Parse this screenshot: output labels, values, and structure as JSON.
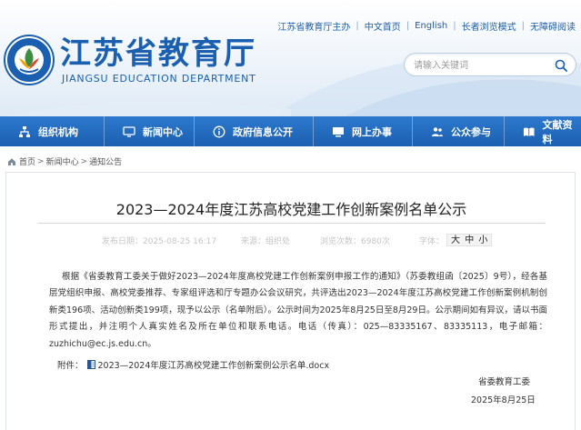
{
  "top_links": [
    "江苏省教育厅主办",
    "中文首页",
    "English",
    "长者浏览模式",
    "无障碍阅读"
  ],
  "site": {
    "name": "江苏省教育厅",
    "name_en": "JIANGSU EDUCATION DEPARTMENT"
  },
  "search": {
    "placeholder": "请输入关键词",
    "icon": "search-icon"
  },
  "nav": [
    {
      "label": "组织机构",
      "icon": "org-chart-icon"
    },
    {
      "label": "新闻中心",
      "icon": "monitor-icon"
    },
    {
      "label": "政府信息公开",
      "icon": "info-icon"
    },
    {
      "label": "网上办事",
      "icon": "computer-icon"
    },
    {
      "label": "公众参与",
      "icon": "people-icon"
    },
    {
      "label": "文献资料",
      "icon": "book-icon"
    }
  ],
  "breadcrumb": [
    "首页",
    "新闻中心",
    "通知公告"
  ],
  "article": {
    "title": "2023—2024年度江苏高校党建工作创新案例名单公示",
    "published": "发布日期：2025-08-25 16:17",
    "source": "来源：组织处",
    "views": "浏览次数：6980次",
    "font_label": "字体：",
    "font_sizes": [
      "大",
      "中",
      "小"
    ],
    "body": "根据《省委教育工委关于做好2023—2024年度高校党建工作创新案例申报工作的通知》（苏委教组函〔2025〕9号），经各基层党组织申报、高校党委推荐、专家组评选和厅专题办公会议研究，共评选出2023—2024年度江苏高校党建工作创新案例机制创新类196项、活动创新类199项，现予以公示（名单附后）。公示时间为2025年8月25日至8月29日。公示期间如有异议，请以书面形式提出，并注明个人真实姓名及所在单位和联系电话。电话（传真）：025—83335167、83335113，电子邮箱：zuzhichu@ec.js.edu.cn。",
    "attachment_label": "附件：",
    "attachment_file": "2023—2024年度江苏高校党建工作创新案例公示名单.docx",
    "signature_org": "省委教育工委",
    "signature_date": "2025年8月25日"
  },
  "colors": {
    "brand": "#1a5fb0",
    "nav": "#2d79cf"
  }
}
